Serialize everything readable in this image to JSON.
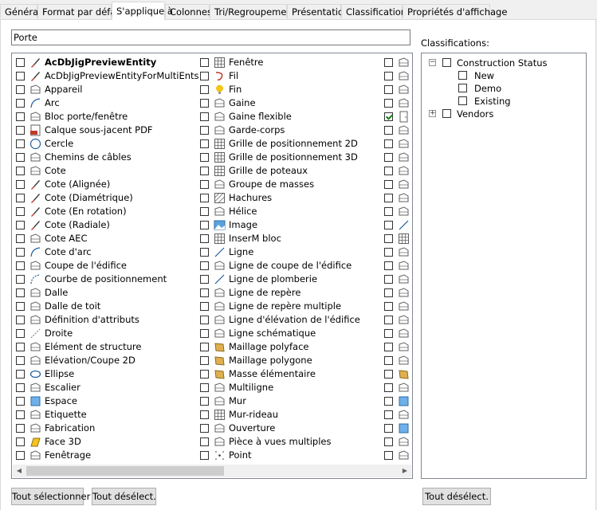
{
  "tabs": [
    {
      "label": "Général",
      "active": false
    },
    {
      "label": "Format par défaut",
      "active": false
    },
    {
      "label": "S'applique à",
      "active": true
    },
    {
      "label": "Colonnes",
      "active": false
    },
    {
      "label": "Tri/Regroupement",
      "active": false
    },
    {
      "label": "Présentation",
      "active": false
    },
    {
      "label": "Classifications",
      "active": false
    },
    {
      "label": "Propriétés d'affichage",
      "active": false
    }
  ],
  "name_field": {
    "value": "Porte"
  },
  "objects_list": {
    "columns": [
      [
        {
          "label": "AcDbJigPreviewEntity",
          "checked": false,
          "icon": "brush-icon"
        },
        {
          "label": "AcDbJigPreviewEntityForMultiEnts",
          "checked": false,
          "icon": "brush-icon"
        },
        {
          "label": "Appareil",
          "checked": false,
          "icon": "appliance-icon"
        },
        {
          "label": "Arc",
          "checked": false,
          "icon": "arc-icon"
        },
        {
          "label": "Bloc porte/fenêtre",
          "checked": false,
          "icon": "door-window-block-icon"
        },
        {
          "label": "Calque sous-jacent PDF",
          "checked": false,
          "icon": "pdf-icon"
        },
        {
          "label": "Cercle",
          "checked": false,
          "icon": "circle-icon"
        },
        {
          "label": "Chemins de câbles",
          "checked": false,
          "icon": "cable-tray-icon"
        },
        {
          "label": "Cote",
          "checked": false,
          "icon": "dimension-icon"
        },
        {
          "label": "Cote (Alignée)",
          "checked": false,
          "icon": "brush-icon"
        },
        {
          "label": "Cote (Diamétrique)",
          "checked": false,
          "icon": "brush-icon"
        },
        {
          "label": "Cote (En rotation)",
          "checked": false,
          "icon": "brush-icon"
        },
        {
          "label": "Cote (Radiale)",
          "checked": false,
          "icon": "brush-icon"
        },
        {
          "label": "Cote AEC",
          "checked": false,
          "icon": "aec-dimension-icon"
        },
        {
          "label": "Cote d'arc",
          "checked": false,
          "icon": "arc-dimension-icon"
        },
        {
          "label": "Coupe de l'édifice",
          "checked": false,
          "icon": "building-section-icon"
        },
        {
          "label": "Courbe de positionnement",
          "checked": false,
          "icon": "layout-curve-icon"
        },
        {
          "label": "Dalle",
          "checked": false,
          "icon": "slab-icon"
        },
        {
          "label": "Dalle de toit",
          "checked": false,
          "icon": "roof-slab-icon"
        },
        {
          "label": "Définition d'attributs",
          "checked": false,
          "icon": "attribute-definition-icon"
        },
        {
          "label": "Droite",
          "checked": false,
          "icon": "xline-icon"
        },
        {
          "label": "Elément de structure",
          "checked": false,
          "icon": "structural-member-icon"
        },
        {
          "label": "Elévation/Coupe 2D",
          "checked": false,
          "icon": "elevation-2d-icon"
        },
        {
          "label": "Ellipse",
          "checked": false,
          "icon": "ellipse-icon"
        },
        {
          "label": "Escalier",
          "checked": false,
          "icon": "stair-icon"
        },
        {
          "label": "Espace",
          "checked": false,
          "icon": "space-icon"
        },
        {
          "label": "Etiquette",
          "checked": false,
          "icon": "tag-icon"
        },
        {
          "label": "Fabrication",
          "checked": false,
          "icon": "fabrication-icon"
        },
        {
          "label": "Face 3D",
          "checked": false,
          "icon": "face-3d-icon"
        },
        {
          "label": "Fenêtrage",
          "checked": false,
          "icon": "viewport-icon"
        }
      ],
      [
        {
          "label": "Fenêtre",
          "checked": false,
          "icon": "window-icon"
        },
        {
          "label": "Fil",
          "checked": false,
          "icon": "wire-icon"
        },
        {
          "label": "Fin",
          "checked": false,
          "icon": "lightbulb-icon"
        },
        {
          "label": "Gaine",
          "checked": false,
          "icon": "duct-icon"
        },
        {
          "label": "Gaine flexible",
          "checked": false,
          "icon": "flex-duct-icon"
        },
        {
          "label": "Garde-corps",
          "checked": false,
          "icon": "railing-icon"
        },
        {
          "label": "Grille de positionnement 2D",
          "checked": false,
          "icon": "grid-2d-icon"
        },
        {
          "label": "Grille de positionnement 3D",
          "checked": false,
          "icon": "grid-3d-icon"
        },
        {
          "label": "Grille de poteaux",
          "checked": false,
          "icon": "column-grid-icon"
        },
        {
          "label": "Groupe de masses",
          "checked": false,
          "icon": "mass-group-icon"
        },
        {
          "label": "Hachures",
          "checked": false,
          "icon": "hatch-icon"
        },
        {
          "label": "Hélice",
          "checked": false,
          "icon": "helix-icon"
        },
        {
          "label": "Image",
          "checked": false,
          "icon": "image-icon"
        },
        {
          "label": "InserM bloc",
          "checked": false,
          "icon": "minsert-block-icon"
        },
        {
          "label": "Ligne",
          "checked": false,
          "icon": "line-icon"
        },
        {
          "label": "Ligne de coupe de l'édifice",
          "checked": false,
          "icon": "section-line-icon"
        },
        {
          "label": "Ligne de plomberie",
          "checked": false,
          "icon": "plumbing-line-icon"
        },
        {
          "label": "Ligne de repère",
          "checked": false,
          "icon": "leader-icon"
        },
        {
          "label": "Ligne de repère multiple",
          "checked": false,
          "icon": "multileader-icon"
        },
        {
          "label": "Ligne d'élévation de l'édifice",
          "checked": false,
          "icon": "elevation-line-icon"
        },
        {
          "label": "Ligne schématique",
          "checked": false,
          "icon": "schematic-line-icon"
        },
        {
          "label": "Maillage polyface",
          "checked": false,
          "icon": "polyface-mesh-icon"
        },
        {
          "label": "Maillage polygone",
          "checked": false,
          "icon": "polygon-mesh-icon"
        },
        {
          "label": "Masse élémentaire",
          "checked": false,
          "icon": "mass-element-icon"
        },
        {
          "label": "Multiligne",
          "checked": false,
          "icon": "mline-icon"
        },
        {
          "label": "Mur",
          "checked": false,
          "icon": "wall-icon"
        },
        {
          "label": "Mur-rideau",
          "checked": false,
          "icon": "curtain-wall-icon"
        },
        {
          "label": "Ouverture",
          "checked": false,
          "icon": "opening-icon"
        },
        {
          "label": "Pièce à vues multiples",
          "checked": false,
          "icon": "multi-view-part-icon"
        },
        {
          "label": "Point",
          "checked": false,
          "icon": "point-icon"
        }
      ],
      [
        {
          "label": "",
          "checked": false,
          "icon": "polyline-icon"
        },
        {
          "label": "",
          "checked": false,
          "icon": "polyline-dashed-icon"
        },
        {
          "label": "",
          "checked": false,
          "icon": "pipe-icon"
        },
        {
          "label": "",
          "checked": false,
          "icon": "pipe-fitting-icon"
        },
        {
          "label": "",
          "checked": true,
          "icon": "door-icon"
        },
        {
          "label": "",
          "checked": false,
          "icon": "pipe-custom-icon"
        },
        {
          "label": "",
          "checked": false,
          "icon": "cylinder-icon"
        },
        {
          "label": "",
          "checked": false,
          "icon": "cable-fitting-icon"
        },
        {
          "label": "",
          "checked": false,
          "icon": "conduit-icon"
        },
        {
          "label": "",
          "checked": false,
          "icon": "region-icon"
        },
        {
          "label": "",
          "checked": false,
          "icon": "elbow-icon"
        },
        {
          "label": "",
          "checked": false,
          "icon": "conduit-fitting-icon"
        },
        {
          "label": "",
          "checked": false,
          "icon": "ray-icon"
        },
        {
          "label": "",
          "checked": false,
          "icon": "table-icon"
        },
        {
          "label": "",
          "checked": false,
          "icon": "text-icon"
        },
        {
          "label": "",
          "checked": false,
          "icon": "body-icon"
        },
        {
          "label": "",
          "checked": false,
          "icon": "shape-icon"
        },
        {
          "label": "",
          "checked": false,
          "icon": "solid-icon"
        },
        {
          "label": "",
          "checked": false,
          "icon": "surface-icon"
        },
        {
          "label": "",
          "checked": false,
          "icon": "spiral-icon"
        },
        {
          "label": "",
          "checked": false,
          "icon": "trace-icon"
        },
        {
          "label": "",
          "checked": false,
          "icon": "box-icon"
        },
        {
          "label": "",
          "checked": false,
          "icon": "toilet-icon"
        },
        {
          "label": "",
          "checked": false,
          "icon": "roof-icon"
        },
        {
          "label": "",
          "checked": false,
          "icon": "duct-fitting-icon"
        },
        {
          "label": "",
          "checked": false,
          "icon": "mvpart-blue-icon"
        },
        {
          "label": "",
          "checked": false,
          "icon": "plane-icon"
        },
        {
          "label": "",
          "checked": false,
          "icon": "tank-icon"
        },
        {
          "label": "",
          "checked": false,
          "icon": "vase-icon"
        },
        {
          "label": "",
          "checked": false,
          "icon": "fixture-icon"
        }
      ]
    ]
  },
  "classifications": {
    "label": "Classifications:",
    "tree": [
      {
        "label": "Construction Status",
        "expanded": true,
        "checked": false,
        "children": [
          {
            "label": "New",
            "checked": false
          },
          {
            "label": "Demo",
            "checked": false
          },
          {
            "label": "Existing",
            "checked": false
          }
        ]
      },
      {
        "label": "Vendors",
        "expanded": false,
        "checked": false,
        "children": []
      }
    ]
  },
  "buttons": {
    "select_all": "Tout sélectionner",
    "deselect_all_left": "Tout désélect.",
    "deselect_all_right": "Tout désélect."
  }
}
